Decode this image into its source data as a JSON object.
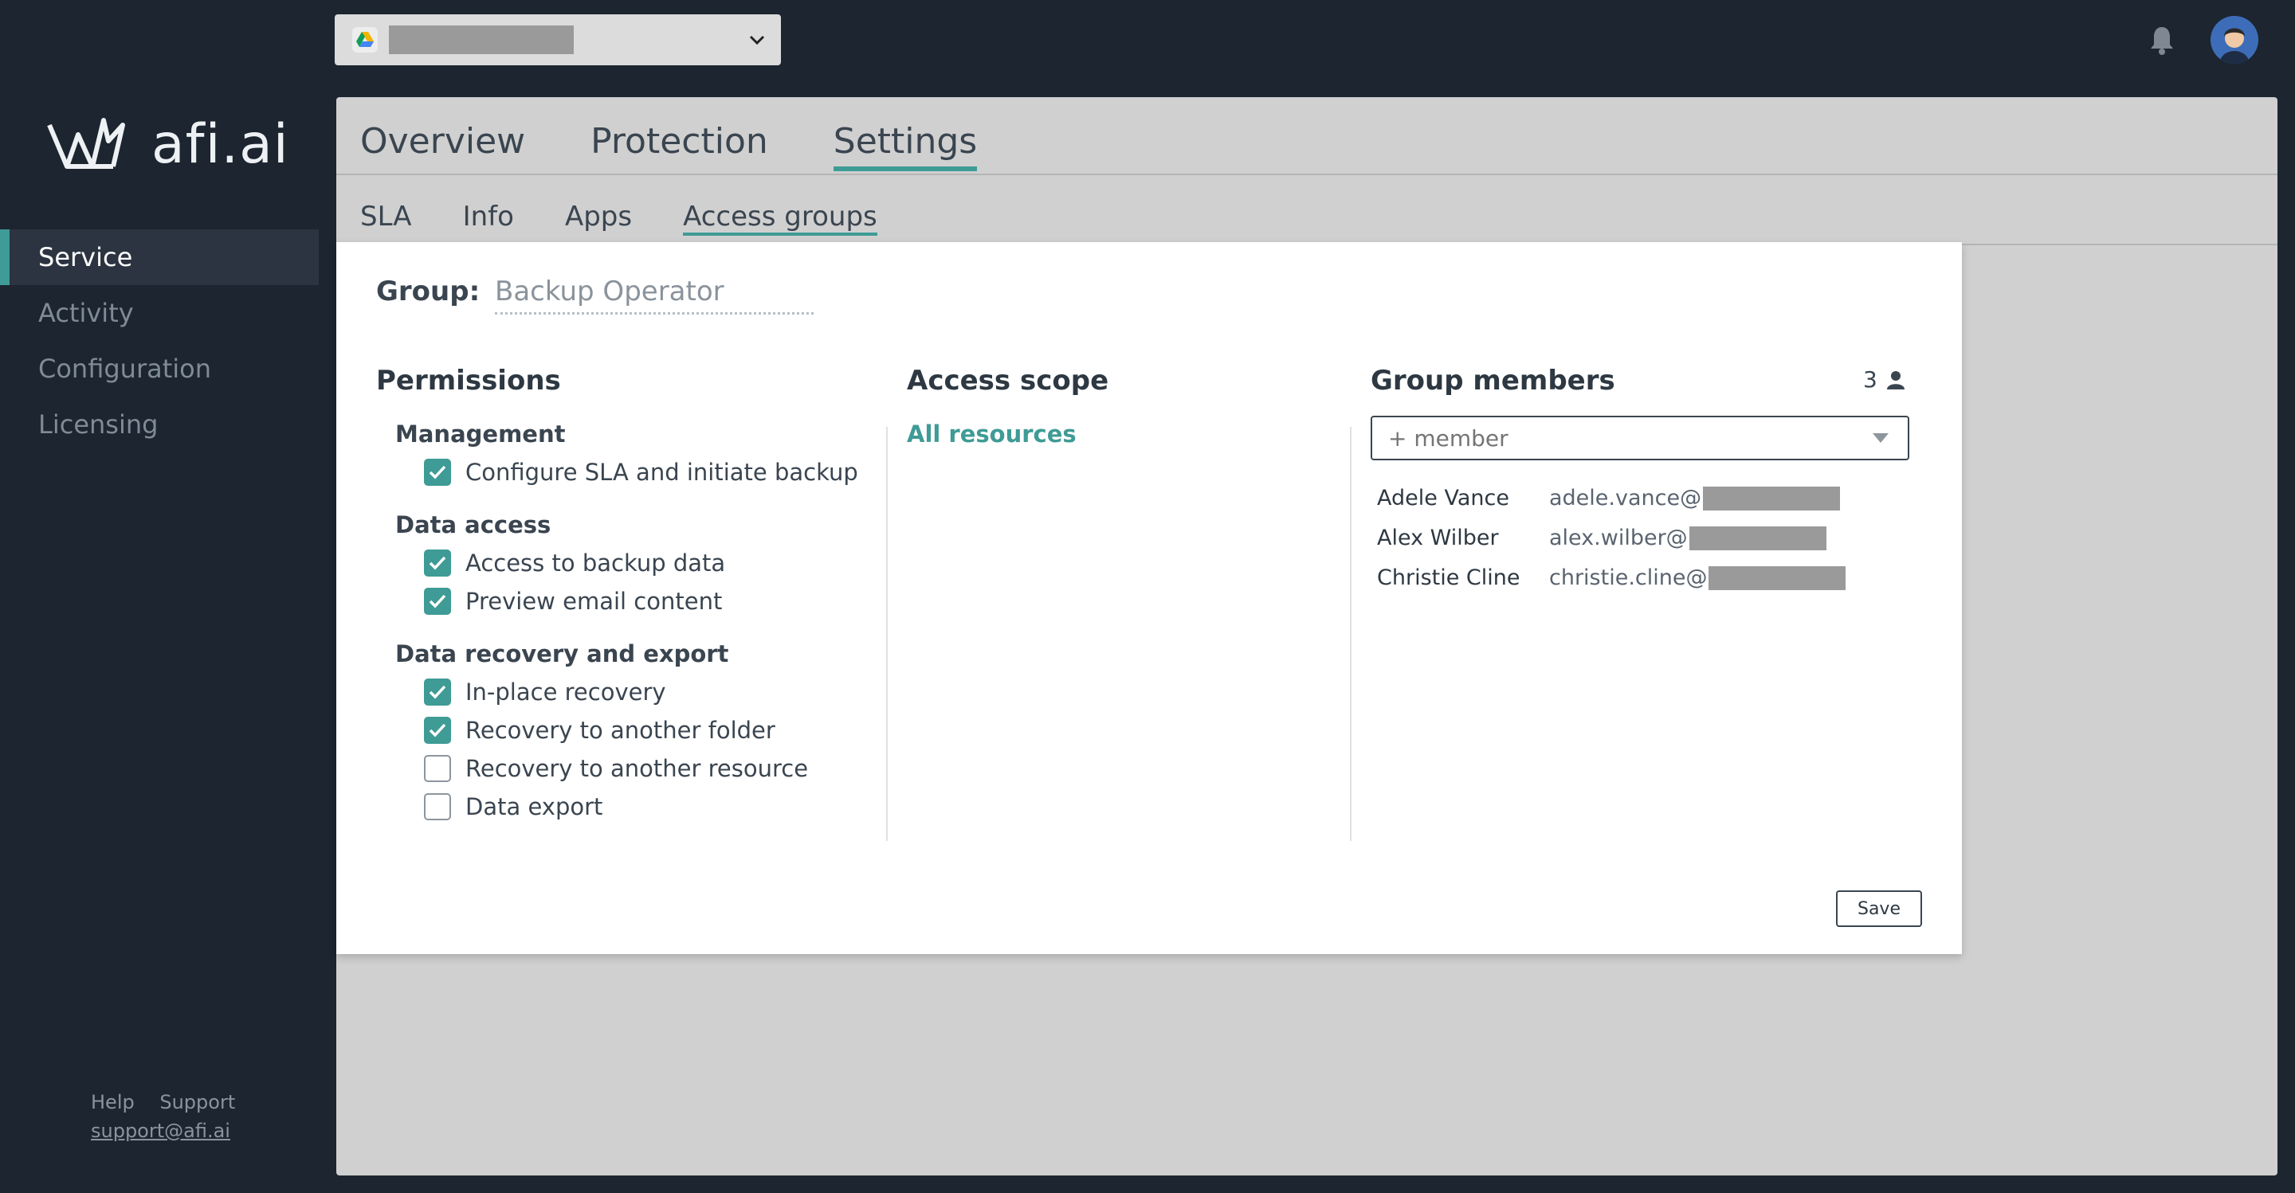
{
  "brand": {
    "logo_text": "afi.ai"
  },
  "sidebar": {
    "items": [
      {
        "label": "Service",
        "active": true
      },
      {
        "label": "Activity"
      },
      {
        "label": "Configuration"
      },
      {
        "label": "Licensing"
      }
    ],
    "footer": {
      "help": "Help",
      "support": "Support",
      "email": "support@afi.ai"
    }
  },
  "topbar": {
    "tenant_icon": "google-drive-icon",
    "notification_icon": "bell-icon"
  },
  "tabs": {
    "main": [
      "Overview",
      "Protection",
      "Settings"
    ],
    "main_active": "Settings",
    "sub": [
      "SLA",
      "Info",
      "Apps",
      "Access groups"
    ],
    "sub_active": "Access groups"
  },
  "dialog": {
    "group_label": "Group:",
    "group_value": "Backup Operator",
    "permissions": {
      "title": "Permissions",
      "sections": [
        {
          "title": "Management",
          "items": [
            {
              "label": "Configure SLA and initiate backup",
              "checked": true
            }
          ]
        },
        {
          "title": "Data access",
          "items": [
            {
              "label": "Access to backup data",
              "checked": true
            },
            {
              "label": "Preview email content",
              "checked": true
            }
          ]
        },
        {
          "title": "Data recovery and export",
          "items": [
            {
              "label": "In-place recovery",
              "checked": true
            },
            {
              "label": "Recovery to another folder",
              "checked": true
            },
            {
              "label": "Recovery to another resource",
              "checked": false
            },
            {
              "label": "Data export",
              "checked": false
            }
          ]
        }
      ]
    },
    "scope": {
      "title": "Access scope",
      "value": "All resources"
    },
    "members": {
      "title": "Group members",
      "count": "3",
      "placeholder": "+ member",
      "list": [
        {
          "name": "Adele Vance",
          "email": "adele.vance@"
        },
        {
          "name": "Alex Wilber",
          "email": "alex.wilber@"
        },
        {
          "name": "Christie Cline",
          "email": "christie.cline@"
        }
      ]
    },
    "save_label": "Save"
  },
  "colors": {
    "accent": "#3f9b95",
    "sidebar_bg": "#1c2530",
    "panel_bg": "#d0d0d0"
  }
}
